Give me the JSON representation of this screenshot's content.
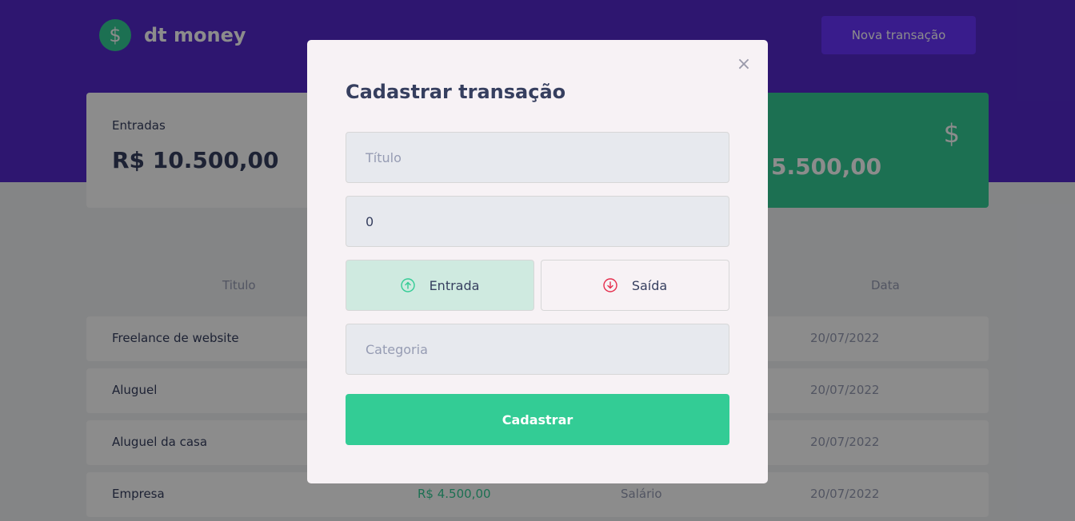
{
  "header": {
    "logo_symbol": "$",
    "logo_text": "dt money",
    "new_transaction_label": "Nova transação"
  },
  "summary": {
    "income_label": "Entradas",
    "income_value": "R$ 10.500,00",
    "total_icon": "$",
    "total_value": "5.500,00"
  },
  "table": {
    "headers": {
      "title": "Titulo",
      "date": "Data"
    },
    "rows": [
      {
        "title": "Freelance de website",
        "amount": "",
        "category": "",
        "date": "20/07/2022"
      },
      {
        "title": "Aluguel",
        "amount": "",
        "category": "",
        "date": "20/07/2022"
      },
      {
        "title": "Aluguel da casa",
        "amount": "",
        "category": "",
        "date": "20/07/2022"
      },
      {
        "title": "Empresa",
        "amount": "R$ 4.500,00",
        "category": "Salário",
        "date": "20/07/2022"
      }
    ]
  },
  "modal": {
    "close_symbol": "×",
    "title": "Cadastrar transação",
    "title_placeholder": "Título",
    "amount_value": "0",
    "income_label": "Entrada",
    "outcome_label": "Saída",
    "category_placeholder": "Categoria",
    "submit_label": "Cadastrar"
  },
  "colors": {
    "brand": "#5429cc",
    "income": "#33cc95",
    "outcome": "#e52e4d"
  }
}
